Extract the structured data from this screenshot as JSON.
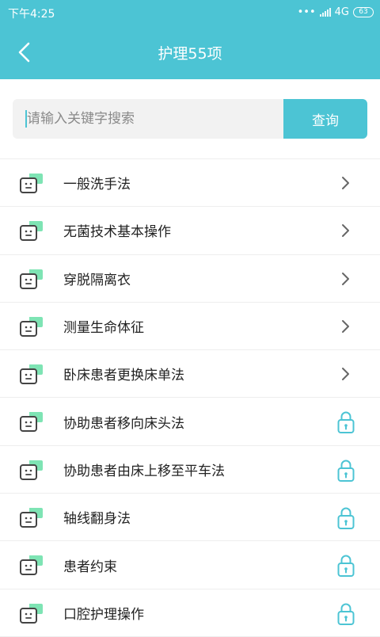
{
  "status": {
    "time": "下午4:25",
    "network": "4G",
    "battery": "63"
  },
  "header": {
    "title": "护理55项"
  },
  "search": {
    "placeholder": "请输入关键字搜索",
    "button_label": "查询"
  },
  "colors": {
    "accent": "#4cc4d4",
    "icon_green": "#7ee4b4",
    "icon_dark": "#444444"
  },
  "items": [
    {
      "label": "一般洗手法",
      "state": "open"
    },
    {
      "label": "无菌技术基本操作",
      "state": "open"
    },
    {
      "label": "穿脱隔离衣",
      "state": "open"
    },
    {
      "label": "测量生命体征",
      "state": "open"
    },
    {
      "label": "卧床患者更换床单法",
      "state": "open"
    },
    {
      "label": "协助患者移向床头法",
      "state": "locked"
    },
    {
      "label": "协助患者由床上移至平车法",
      "state": "locked"
    },
    {
      "label": "轴线翻身法",
      "state": "locked"
    },
    {
      "label": "患者约束",
      "state": "locked"
    },
    {
      "label": "口腔护理操作",
      "state": "locked"
    }
  ]
}
